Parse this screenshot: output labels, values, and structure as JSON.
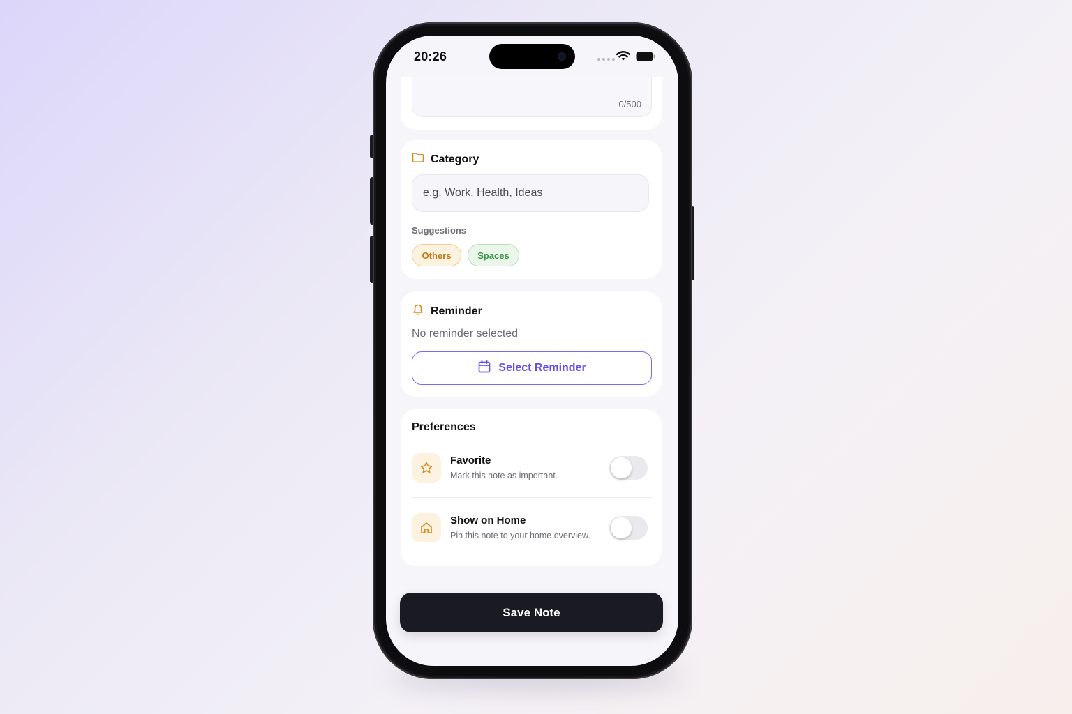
{
  "status_bar": {
    "time": "20:26"
  },
  "note_field": {
    "counter": "0/500"
  },
  "category": {
    "title": "Category",
    "placeholder": "e.g. Work, Health, Ideas",
    "suggestions_label": "Suggestions",
    "suggestions": [
      "Others",
      "Spaces"
    ]
  },
  "reminder": {
    "title": "Reminder",
    "status": "No reminder selected",
    "button_label": "Select Reminder"
  },
  "preferences": {
    "title": "Preferences",
    "items": [
      {
        "title": "Favorite",
        "description": "Mark this note as important.",
        "enabled": false,
        "icon": "star-icon"
      },
      {
        "title": "Show on Home",
        "description": "Pin this note to your home overview.",
        "enabled": false,
        "icon": "home-icon"
      }
    ]
  },
  "actions": {
    "save_label": "Save Note"
  },
  "colors": {
    "accent": "#6a4fe6",
    "orange": "#d98a1c",
    "green": "#3c9446",
    "dark": "#1a1a22"
  }
}
